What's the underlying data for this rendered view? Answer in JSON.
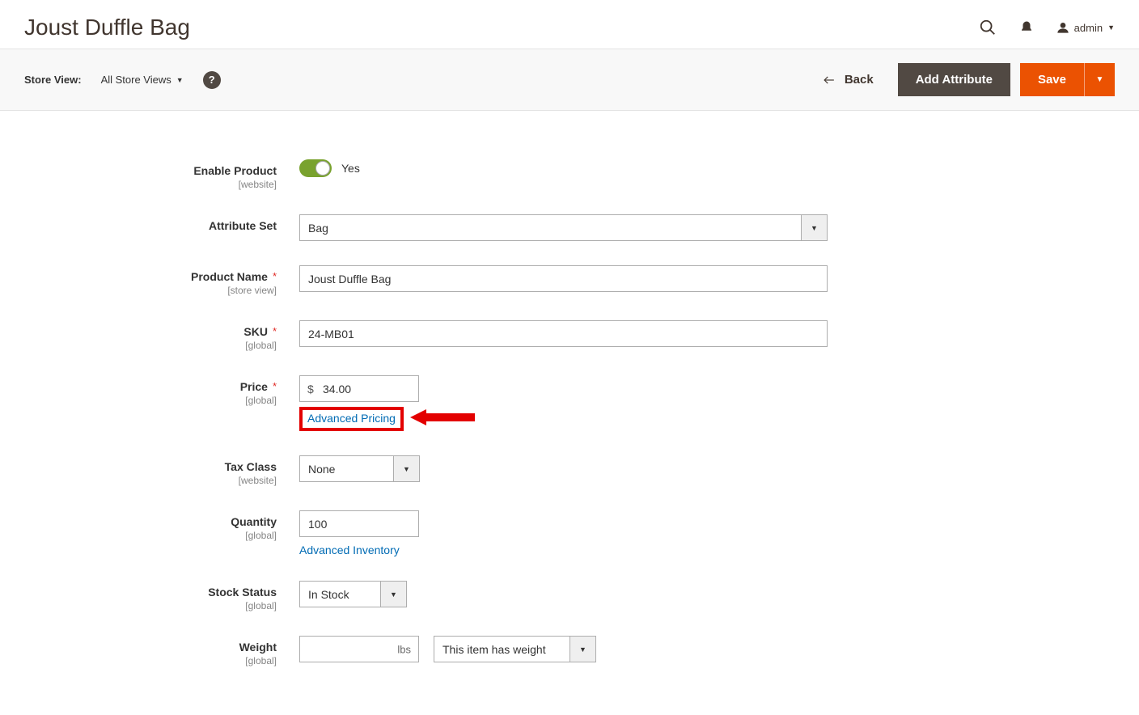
{
  "header": {
    "title": "Joust Duffle Bag",
    "user_label": "admin"
  },
  "toolbar": {
    "store_view_label": "Store View:",
    "store_view_value": "All Store Views",
    "back_label": "Back",
    "add_attribute_label": "Add Attribute",
    "save_label": "Save"
  },
  "fields": {
    "enable_product": {
      "label": "Enable Product",
      "scope": "[website]",
      "value_label": "Yes"
    },
    "attribute_set": {
      "label": "Attribute Set",
      "value": "Bag"
    },
    "product_name": {
      "label": "Product Name",
      "scope": "[store view]",
      "value": "Joust Duffle Bag"
    },
    "sku": {
      "label": "SKU",
      "scope": "[global]",
      "value": "24-MB01"
    },
    "price": {
      "label": "Price",
      "scope": "[global]",
      "currency": "$",
      "value": "34.00",
      "advanced_link": "Advanced Pricing"
    },
    "tax_class": {
      "label": "Tax Class",
      "scope": "[website]",
      "value": "None"
    },
    "quantity": {
      "label": "Quantity",
      "scope": "[global]",
      "value": "100",
      "advanced_link": "Advanced Inventory"
    },
    "stock_status": {
      "label": "Stock Status",
      "scope": "[global]",
      "value": "In Stock"
    },
    "weight": {
      "label": "Weight",
      "scope": "[global]",
      "unit": "lbs",
      "value": "",
      "has_weight_value": "This item has weight"
    }
  }
}
